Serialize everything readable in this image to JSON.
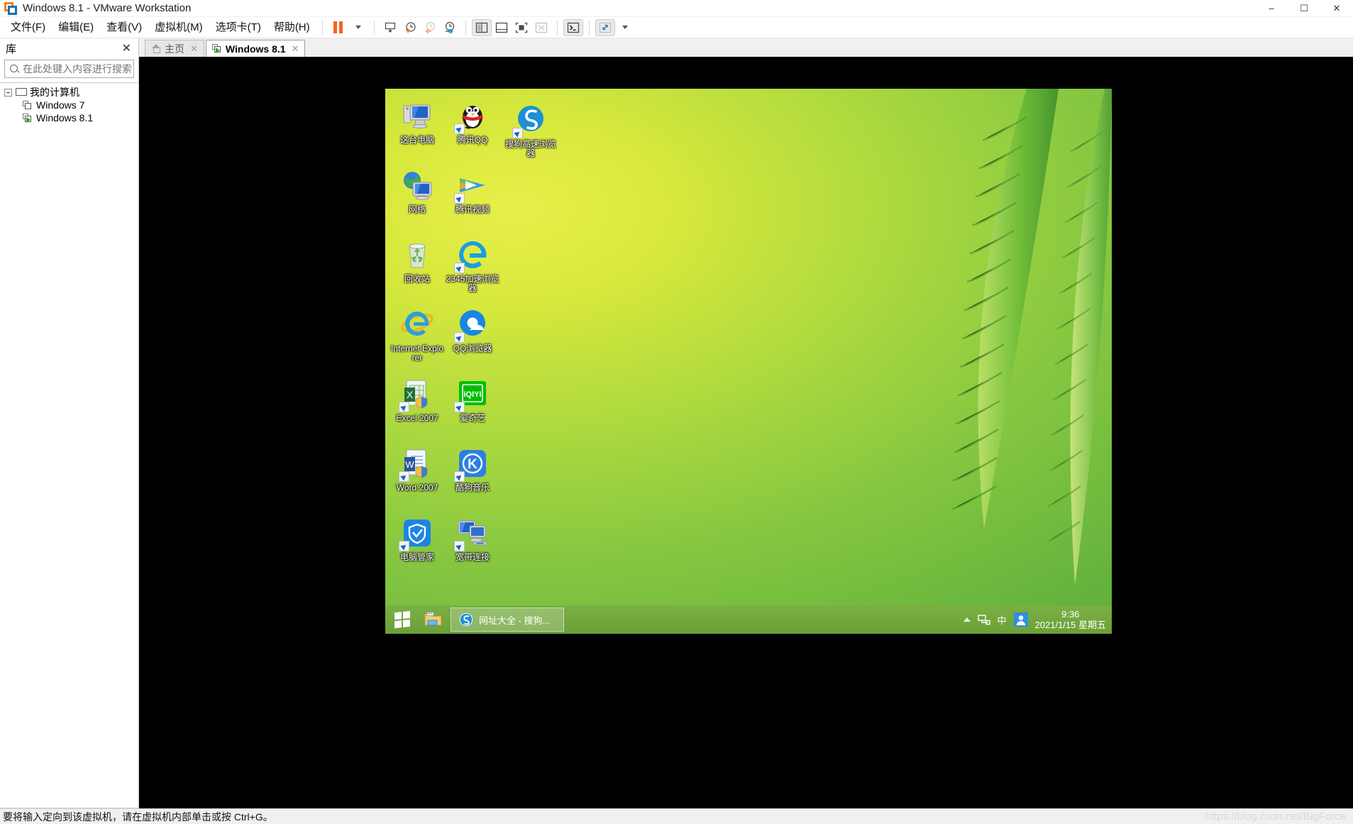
{
  "window": {
    "title": "Windows 8.1 - VMware Workstation",
    "app_icon": "vmware-icon",
    "minimize": "–",
    "maximize": "☐",
    "close": "✕"
  },
  "menubar": {
    "items": [
      {
        "label": "文件(F)",
        "name": "menu-file"
      },
      {
        "label": "编辑(E)",
        "name": "menu-edit"
      },
      {
        "label": "查看(V)",
        "name": "menu-view"
      },
      {
        "label": "虚拟机(M)",
        "name": "menu-vm"
      },
      {
        "label": "选项卡(T)",
        "name": "menu-tabs"
      },
      {
        "label": "帮助(H)",
        "name": "menu-help"
      }
    ]
  },
  "toolbar": {
    "buttons": [
      {
        "name": "suspend-button",
        "icon": "pause-icon",
        "tip": "挂起"
      },
      {
        "name": "power-dropdown",
        "icon": "chevron-down-icon",
        "tip": "电源菜单"
      },
      {
        "name": "snapshot-button",
        "icon": "snapshot-icon",
        "tip": "快照"
      },
      {
        "name": "take-snapshot-button",
        "icon": "clock-plus-icon",
        "tip": "拍摄此虚拟机的快照"
      },
      {
        "name": "revert-snapshot-button",
        "icon": "clock-back-icon",
        "tip": "恢复到快照"
      },
      {
        "name": "manage-snapshots-button",
        "icon": "clock-settings-icon",
        "tip": "管理快照"
      },
      {
        "name": "show-library-button",
        "icon": "sidebar-panel-icon",
        "tip": "显示或隐藏库"
      },
      {
        "name": "show-thumbnails-button",
        "icon": "bottom-panel-icon",
        "tip": "显示或隐藏缩略图栏"
      },
      {
        "name": "show-console-view-button",
        "icon": "console-frame-icon",
        "tip": "控制台视图"
      },
      {
        "name": "fit-guest-button",
        "icon": "fit-window-icon",
        "tip": "适应客户机"
      },
      {
        "name": "console-button",
        "icon": "terminal-icon",
        "tip": "发送 Ctrl+Alt+Del"
      },
      {
        "name": "fullscreen-button",
        "icon": "expand-arrows-icon",
        "tip": "进入全屏"
      },
      {
        "name": "fullscreen-dropdown",
        "icon": "chevron-down-icon",
        "tip": "全屏选项"
      }
    ]
  },
  "sidebar": {
    "title": "库",
    "close_icon": "close-icon",
    "search": {
      "placeholder": "在此处键入内容进行搜索",
      "value": "",
      "icon": "search-icon",
      "dropdown_icon": "chevron-down-icon"
    },
    "tree": {
      "root": {
        "label": "我的计算机",
        "icon": "monitor-icon",
        "expanded": true
      },
      "children": [
        {
          "label": "Windows 7",
          "icon": "vm-icon",
          "running": false
        },
        {
          "label": "Windows 8.1",
          "icon": "vm-running-icon",
          "running": true
        }
      ]
    }
  },
  "tabs": [
    {
      "label": "主页",
      "icon": "home-icon",
      "active": false,
      "close_icon": "✕"
    },
    {
      "label": "Windows 8.1",
      "icon": "vm-running-icon",
      "active": true,
      "close_icon": "✕"
    }
  ],
  "guest": {
    "os": "Windows 8.1",
    "desktop_icons": [
      {
        "label": "这台电脑",
        "icon": "this-pc-icon",
        "shortcut": false
      },
      {
        "label": "腾讯QQ",
        "icon": "qq-penguin-icon",
        "shortcut": true
      },
      {
        "label": "搜狗高速浏览器",
        "icon": "sogou-browser-icon",
        "shortcut": true
      },
      {
        "label": "网络",
        "icon": "network-icon",
        "shortcut": false
      },
      {
        "label": "腾讯视频",
        "icon": "tencent-video-icon",
        "shortcut": true
      },
      {
        "label": "回收站",
        "icon": "recycle-bin-icon",
        "shortcut": false
      },
      {
        "label": "2345加速浏览器",
        "icon": "browser-2345-icon",
        "shortcut": true
      },
      {
        "label": "Internet Explorer",
        "icon": "internet-explorer-icon",
        "shortcut": false
      },
      {
        "label": "QQ浏览器",
        "icon": "qq-browser-icon",
        "shortcut": true
      },
      {
        "label": "Excel 2007",
        "icon": "excel-icon",
        "shortcut": true
      },
      {
        "label": "爱奇艺",
        "icon": "iqiyi-icon",
        "shortcut": true
      },
      {
        "label": "Word 2007",
        "icon": "word-icon",
        "shortcut": true
      },
      {
        "label": "酷狗音乐",
        "icon": "kugou-music-icon",
        "shortcut": true
      },
      {
        "label": "电脑管家",
        "icon": "pc-manager-icon",
        "shortcut": true
      },
      {
        "label": "宽带连接",
        "icon": "broadband-connection-icon",
        "shortcut": true
      }
    ],
    "taskbar": {
      "start_icon": "windows-start-icon",
      "pinned": [
        {
          "name": "file-explorer",
          "icon": "folder-icon"
        }
      ],
      "tasks": [
        {
          "label": "网址大全 - 搜狗...",
          "icon": "sogou-browser-icon"
        }
      ],
      "tray": {
        "overflow_icon": "chevron-up-icon",
        "network_icon": "network-tray-icon",
        "ime_label": "中",
        "qq_icon": "qq-avatar-icon",
        "time": "9:36",
        "date": "2021/1/15 星期五"
      }
    }
  },
  "statusbar": {
    "message": "要将输入定向到该虚拟机，请在虚拟机内部单击或按 Ctrl+G。",
    "watermark": "https://blog.csdn.net/BigForce"
  },
  "colors": {
    "accent_orange": "#f26522",
    "accent_blue": "#1a6fb5",
    "taskbar_green": "#6aa038",
    "desktop_yellow": "#d7e83c",
    "desktop_green": "#63b23d"
  }
}
